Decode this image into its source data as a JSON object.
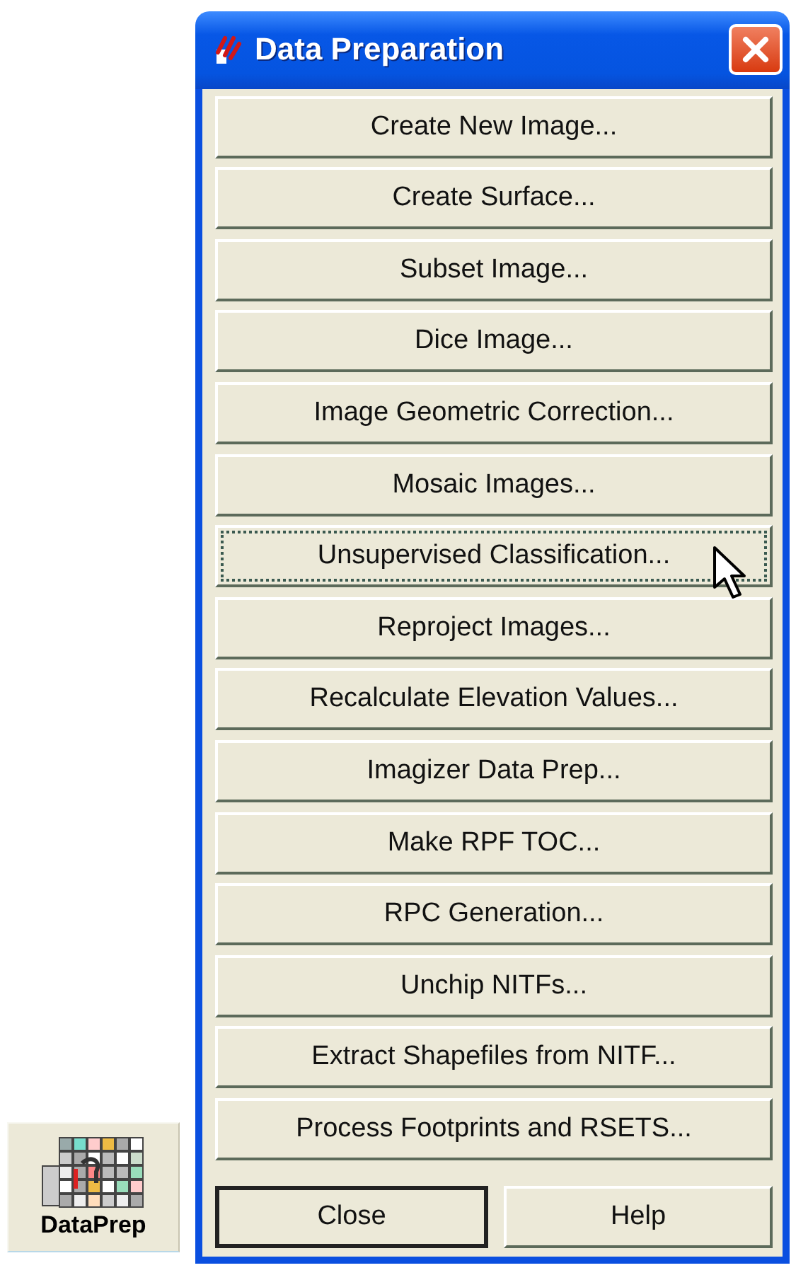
{
  "desktop_icon": {
    "label": "DataPrep"
  },
  "window": {
    "title": "Data Preparation"
  },
  "buttons": [
    {
      "label": "Create New Image...",
      "focused": false
    },
    {
      "label": "Create Surface...",
      "focused": false
    },
    {
      "label": "Subset Image...",
      "focused": false
    },
    {
      "label": "Dice Image...",
      "focused": false
    },
    {
      "label": "Image Geometric Correction...",
      "focused": false
    },
    {
      "label": "Mosaic Images...",
      "focused": false
    },
    {
      "label": "Unsupervised Classification...",
      "focused": true
    },
    {
      "label": "Reproject Images...",
      "focused": false
    },
    {
      "label": "Recalculate Elevation Values...",
      "focused": false
    },
    {
      "label": "Imagizer Data Prep...",
      "focused": false
    },
    {
      "label": "Make RPF TOC...",
      "focused": false
    },
    {
      "label": "RPC Generation...",
      "focused": false
    },
    {
      "label": "Unchip NITFs...",
      "focused": false
    },
    {
      "label": "Extract Shapefiles from NITF...",
      "focused": false
    },
    {
      "label": "Process Footprints and RSETS...",
      "focused": false
    }
  ],
  "footer_buttons": [
    {
      "label": "Close",
      "default": true
    },
    {
      "label": "Help",
      "default": false
    }
  ]
}
